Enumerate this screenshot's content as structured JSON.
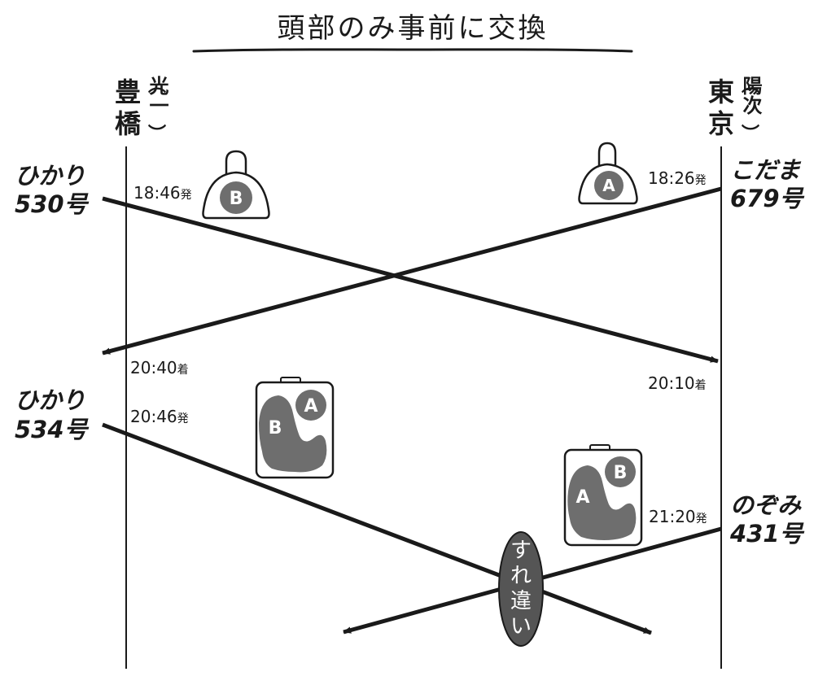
{
  "title": "頭部のみ事前に交換",
  "stations": {
    "left": {
      "name_chars": [
        "豊",
        "橋"
      ],
      "person": "光一",
      "bracket_top": "︵",
      "bracket_bottom": "︶"
    },
    "right": {
      "name_chars": [
        "東",
        "京"
      ],
      "person": "陽次",
      "bracket_top": "︵",
      "bracket_bottom": "︶"
    }
  },
  "trains": {
    "hikari530": {
      "line1": "ひかり",
      "line2": "530号",
      "time": "18:46",
      "time_suffix": "発",
      "arrive_time": "20:10",
      "arrive_suffix": "着"
    },
    "kodama679": {
      "line1": "こだま",
      "line2": "679号",
      "time": "18:26",
      "time_suffix": "発",
      "arrive_time": "20:40",
      "arrive_suffix": "着"
    },
    "hikari534": {
      "line1": "ひかり",
      "line2": "534号",
      "time": "20:46",
      "time_suffix": "発"
    },
    "nozomi431": {
      "line1": "のぞみ",
      "line2": "431号",
      "time": "21:20",
      "time_suffix": "発"
    }
  },
  "bags": {
    "small_left": {
      "letter": "B"
    },
    "small_right": {
      "letter": "A"
    },
    "big_left": {
      "head_letter": "A",
      "body_letter": "B"
    },
    "big_right": {
      "head_letter": "B",
      "body_letter": "A"
    }
  },
  "passing": {
    "chars": [
      "す",
      "れ",
      "違",
      "い"
    ]
  },
  "colors": {
    "line": "#1a1a1a",
    "bag_fill": "#6e6e6e",
    "bag_outline": "#1a1a1a",
    "oval_fill": "#555555"
  }
}
